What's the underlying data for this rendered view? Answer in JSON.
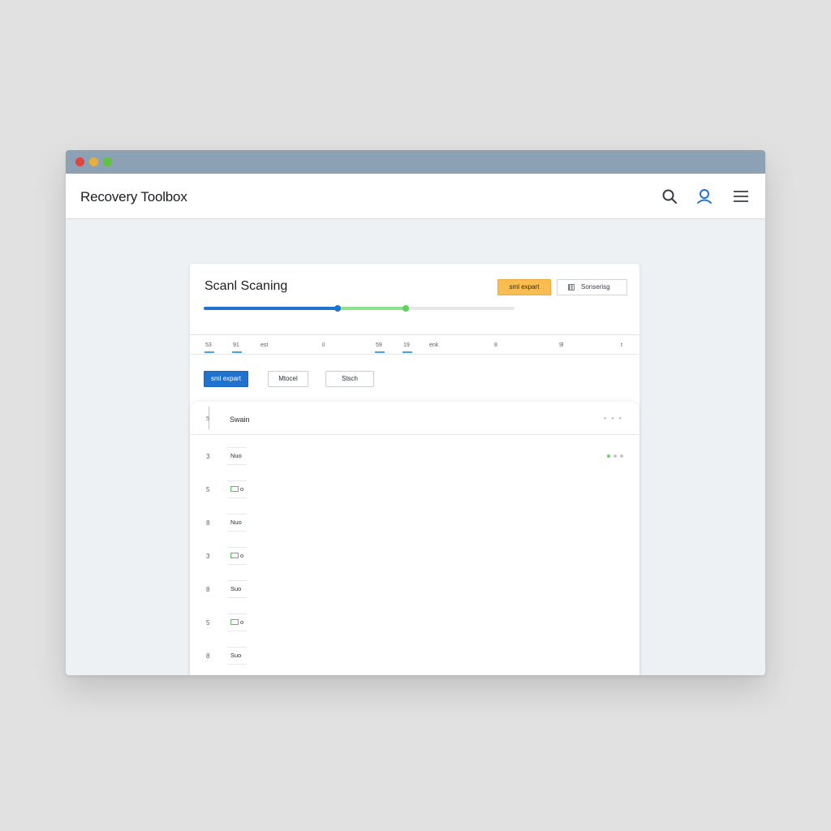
{
  "window": {
    "app_title": "Recovery Toolbox"
  },
  "icons": {
    "search": "search-icon",
    "user": "user-icon",
    "menu": "menu-icon"
  },
  "scan": {
    "title": "Scanl Scaning",
    "export_label": "sml expart",
    "status_label": "Sonserisg",
    "progress_primary": 0.43,
    "progress_secondary": 0.65
  },
  "columns": [
    "53",
    "91",
    "est",
    "il",
    "59",
    "19",
    "enk",
    "8",
    "9l",
    "t"
  ],
  "actions": {
    "primary_label": "sml expart",
    "model_label": "Mtocel",
    "search_label": "Stsch"
  },
  "list": {
    "header_index": "5",
    "header_label": "Swain",
    "rows": [
      {
        "index": "3",
        "value": "Nuo",
        "type": "text",
        "status": "ok"
      },
      {
        "index": "5",
        "value": "o",
        "type": "file"
      },
      {
        "index": "8",
        "value": "Nuo",
        "type": "text"
      },
      {
        "index": "3",
        "value": "o",
        "type": "file"
      },
      {
        "index": "8",
        "value": "Suo",
        "type": "text"
      },
      {
        "index": "5",
        "value": "o",
        "type": "file"
      },
      {
        "index": "8",
        "value": "Suo",
        "type": "text"
      }
    ]
  },
  "colors": {
    "accent_blue": "#1e73d0",
    "accent_green": "#5fd35a",
    "accent_orange": "#f7bd52",
    "titlebar": "#8ca2b4"
  }
}
